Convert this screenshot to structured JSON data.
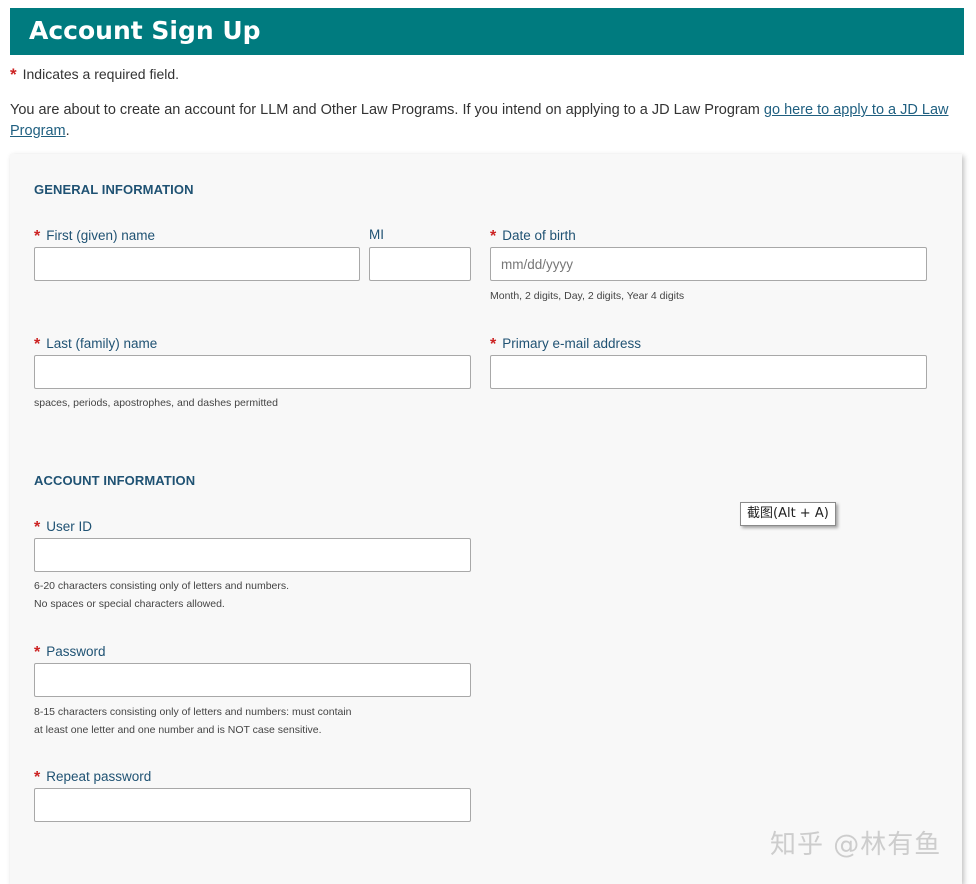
{
  "header": {
    "title": "Account Sign Up"
  },
  "required_note": {
    "star": "*",
    "text": "Indicates a required field."
  },
  "intro": {
    "text": "You are about to create an account for LLM and Other Law Programs. If you intend on applying to a JD Law Program ",
    "link": "go here to apply to a JD Law Program",
    "suffix": "."
  },
  "general": {
    "title": "GENERAL INFORMATION",
    "first_name": {
      "label": "First (given) name",
      "required": "*",
      "value": ""
    },
    "mi": {
      "label": "MI",
      "value": ""
    },
    "dob": {
      "label": "Date of birth",
      "required": "*",
      "placeholder": "mm/dd/yyyy",
      "hint": "Month, 2 digits, Day, 2 digits, Year 4 digits"
    },
    "last_name": {
      "label": "Last (family) name",
      "required": "*",
      "value": "",
      "hint": "spaces, periods, apostrophes, and dashes permitted"
    },
    "email": {
      "label": "Primary e-mail address",
      "required": "*",
      "value": ""
    }
  },
  "account": {
    "title": "ACCOUNT INFORMATION",
    "user_id": {
      "label": "User ID",
      "required": "*",
      "value": "",
      "hint1": "6-20 characters consisting only of letters and numbers.",
      "hint2": "No spaces or special characters allowed."
    },
    "password": {
      "label": "Password",
      "required": "*",
      "value": "",
      "hint1": "8-15 characters consisting only of letters and numbers: must contain",
      "hint2": "at least one letter and one number and is NOT case sensitive."
    },
    "repeat_password": {
      "label": "Repeat password",
      "required": "*",
      "value": ""
    }
  },
  "tooltip": {
    "text": "截图(Alt + A)"
  },
  "watermark": {
    "text": "知乎 @林有鱼"
  },
  "colors": {
    "header_bg": "#007b7f",
    "label": "#1f5273",
    "required": "#cc2222",
    "link": "#1f5f80"
  }
}
